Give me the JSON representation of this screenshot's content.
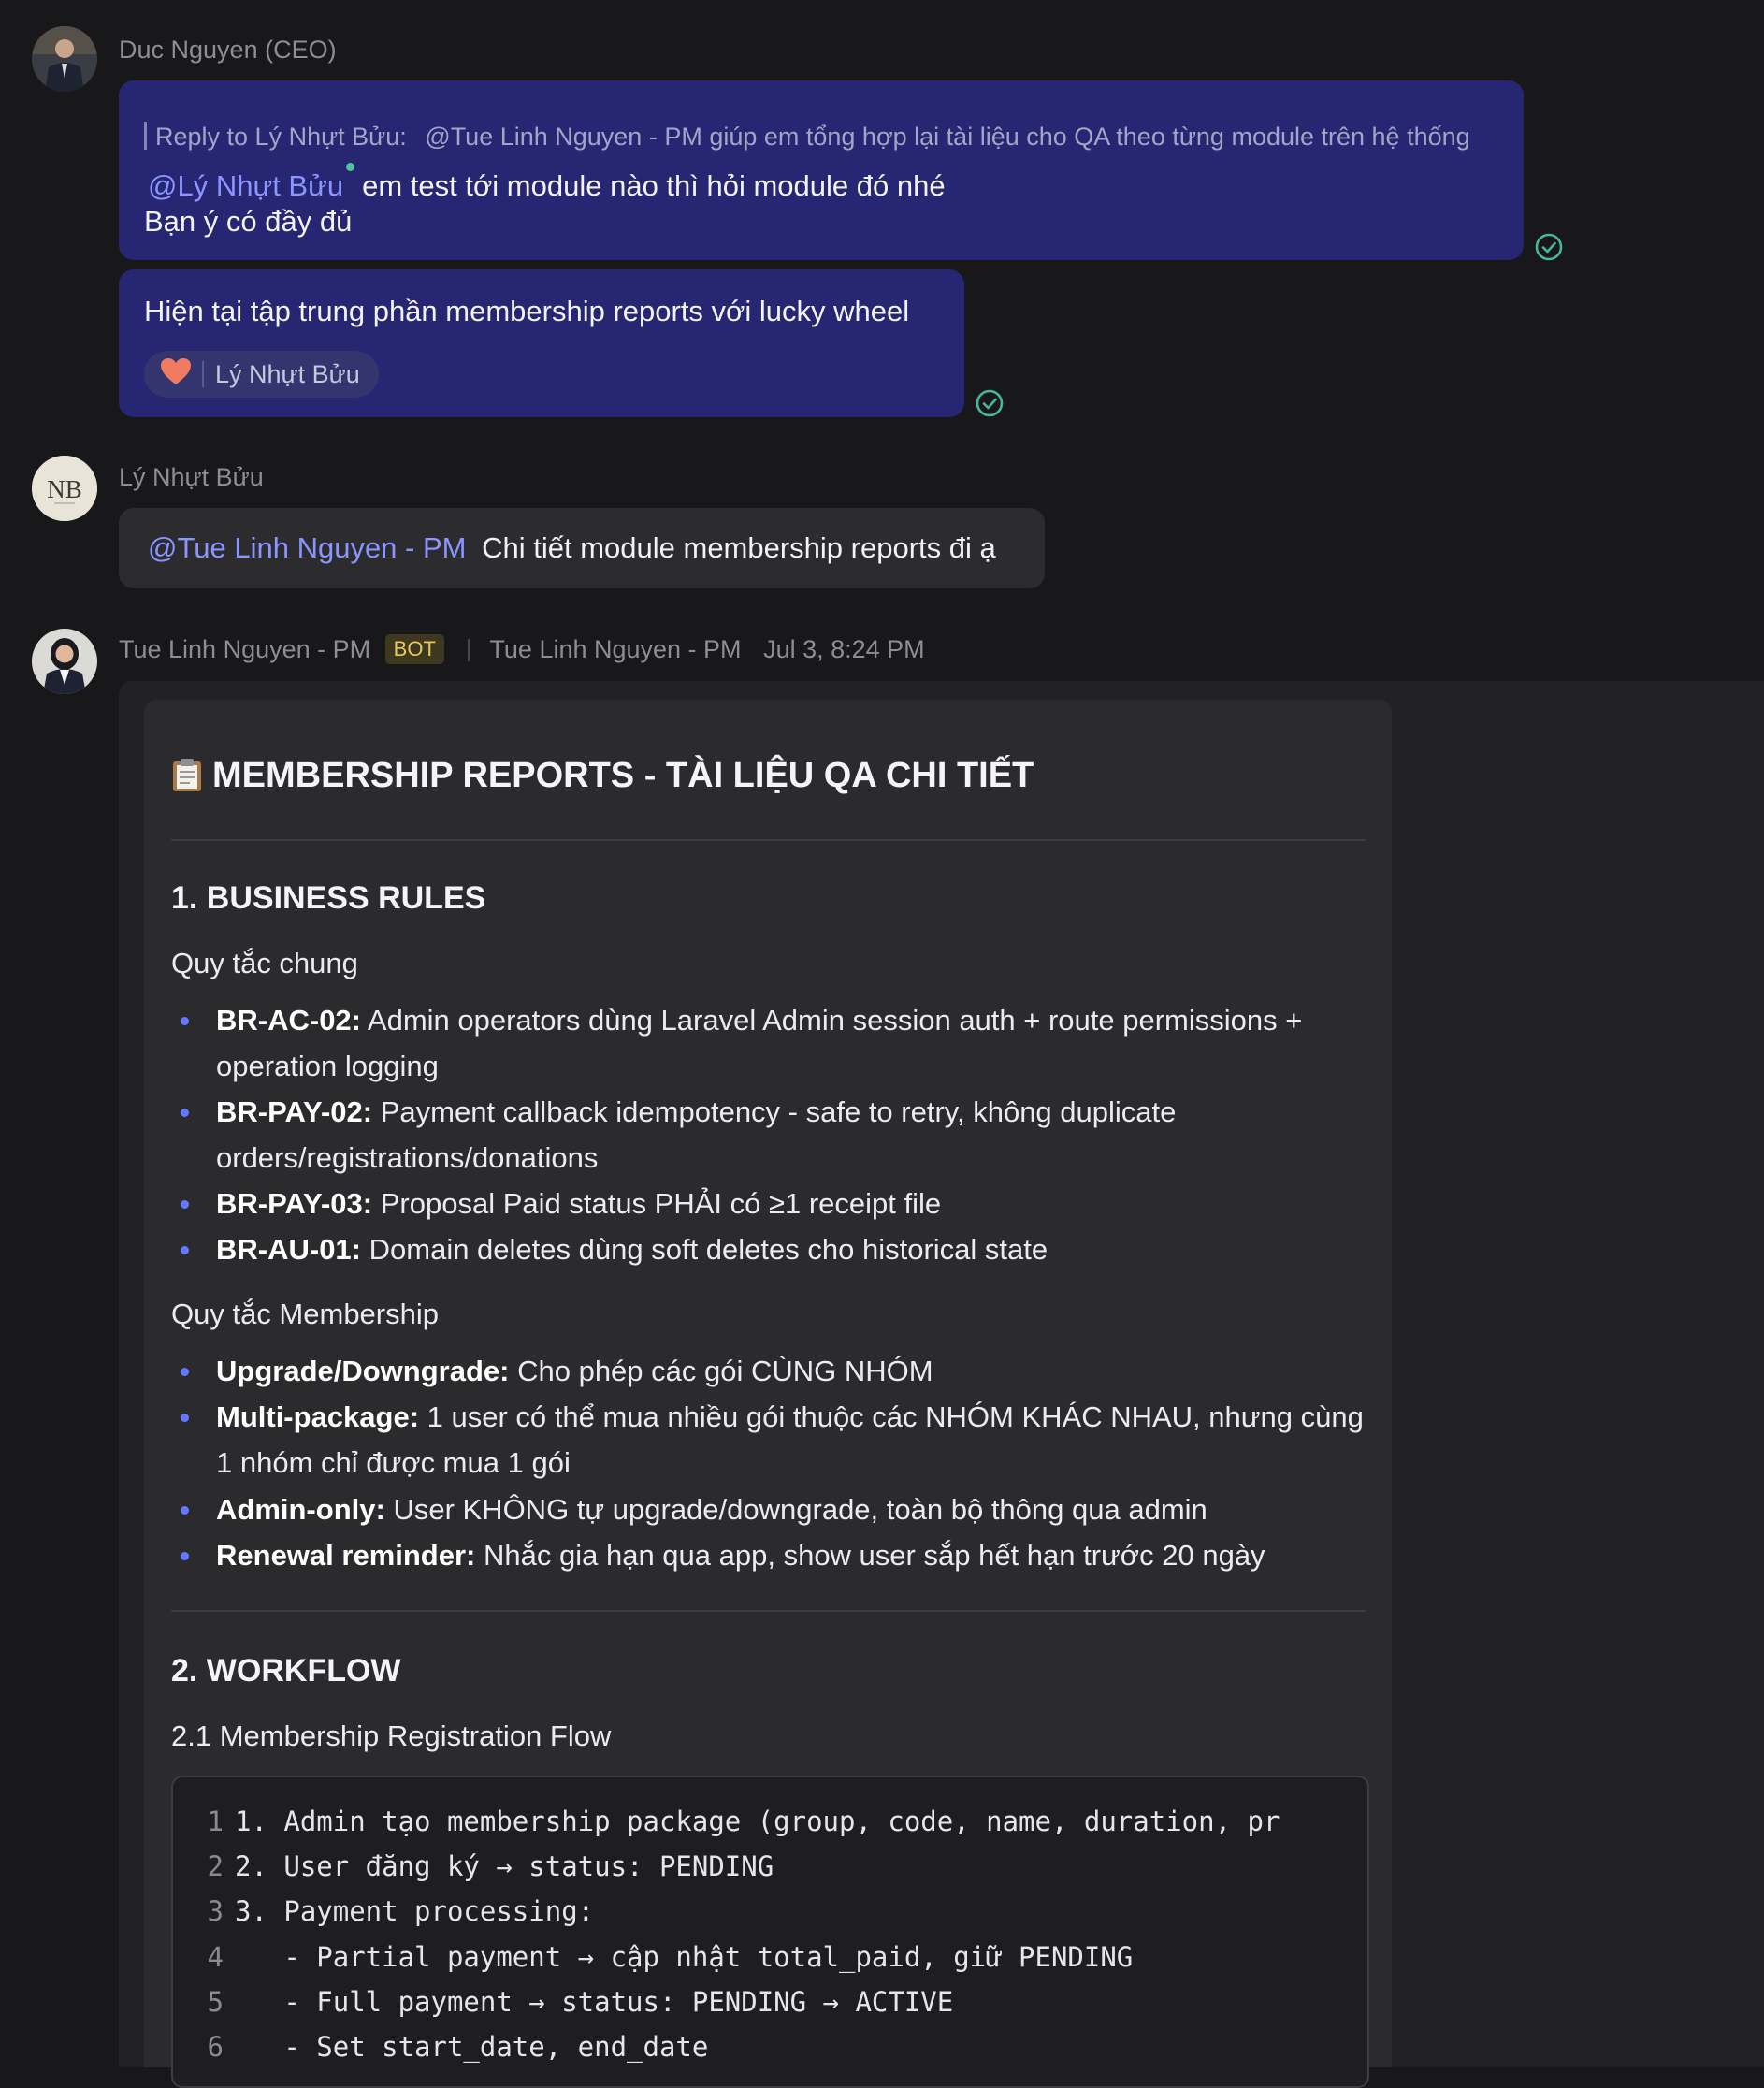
{
  "messages": {
    "ceo": {
      "sender": "Duc Nguyen (CEO)",
      "reply_prefix": "Reply to Lý Nhựt Bửu:",
      "reply_text": "@Tue Linh Nguyen - PM giúp em tổng hợp lại tài liệu cho QA theo từng module trên hệ thống",
      "mention": "@Lý Nhựt Bửu",
      "line1_rest": "em test tới module nào thì hỏi module đó nhé",
      "line2": "Bạn ý có đầy đủ",
      "second_text": "Hiện tại tập trung phần membership reports với lucky wheel",
      "reaction_emoji": "❤️",
      "reaction_user": "Lý Nhựt Bửu"
    },
    "buu": {
      "sender": "Lý Nhựt Bửu",
      "avatar_initials": "NB",
      "mention": "@Tue Linh Nguyen - PM",
      "text": "Chi tiết module membership reports đi ạ"
    },
    "bot": {
      "sender": "Tue Linh Nguyen - PM",
      "badge": "BOT",
      "sender_alt": "Tue Linh Nguyen - PM",
      "timestamp": "Jul 3, 8:24 PM"
    }
  },
  "doc": {
    "title": "MEMBERSHIP REPORTS - TÀI LIỆU QA CHI TIẾT",
    "section1": {
      "heading": "1. BUSINESS RULES",
      "sub1": "Quy tắc chung",
      "rules1": [
        {
          "key": "BR-AC-02:",
          "text": "Admin operators dùng Laravel Admin session auth + route permissions + operation logging"
        },
        {
          "key": "BR-PAY-02:",
          "text": "Payment callback idempotency - safe to retry, không duplicate orders/registrations/donations"
        },
        {
          "key": "BR-PAY-03:",
          "text": "Proposal Paid status PHẢI có ≥1 receipt file"
        },
        {
          "key": "BR-AU-01:",
          "text": "Domain deletes dùng soft deletes cho historical state"
        }
      ],
      "sub2": "Quy tắc Membership",
      "rules2": [
        {
          "key": "Upgrade/Downgrade:",
          "text": "Cho phép các gói CÙNG NHÓM"
        },
        {
          "key": "Multi-package:",
          "text": "1 user có thể mua nhiều gói thuộc các NHÓM KHÁC NHAU, nhưng cùng 1 nhóm chỉ được mua 1 gói"
        },
        {
          "key": "Admin-only:",
          "text": "User KHÔNG tự upgrade/downgrade, toàn bộ thông qua admin"
        },
        {
          "key": "Renewal reminder:",
          "text": "Nhắc gia hạn qua app, show user sắp hết hạn trước 20 ngày"
        }
      ]
    },
    "section2": {
      "heading": "2. WORKFLOW",
      "sub1": "2.1 Membership Registration Flow",
      "code": [
        {
          "n": "1",
          "text": "1. Admin tạo membership package (group, code, name, duration, pr"
        },
        {
          "n": "2",
          "text": "2. User đăng ký → status: PENDING"
        },
        {
          "n": "3",
          "text": "3. Payment processing:"
        },
        {
          "n": "4",
          "text": "   - Partial payment → cập nhật total_paid, giữ PENDING"
        },
        {
          "n": "5",
          "text": "   - Full payment → status: PENDING → ACTIVE"
        },
        {
          "n": "6",
          "text": "   - Set start_date, end_date"
        }
      ]
    }
  }
}
